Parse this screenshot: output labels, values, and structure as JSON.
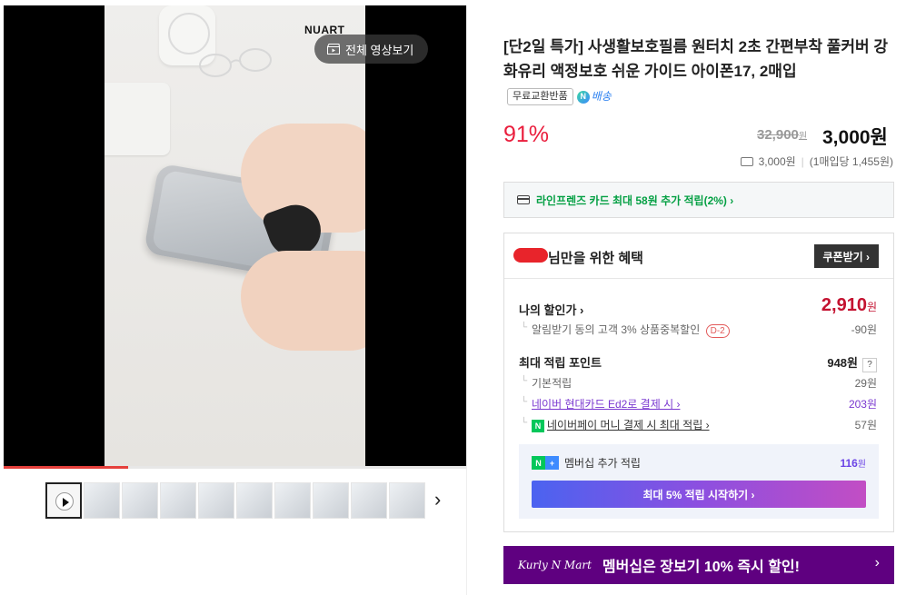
{
  "media": {
    "brand": "NUART",
    "video_button_label": "전체 영상보기",
    "progress_percent": 27
  },
  "thumbnails": {
    "count": 10,
    "next_label": "›"
  },
  "product": {
    "title": "[단2일 특가] 사생활보호필름 원터치 2초 간편부착 풀커버 강화유리 액정보호 쉬운 가이드 아이폰17, 2매입",
    "badge_free_exchange": "무료교환반품",
    "badge_delivery": "배송",
    "discount_rate": "91%",
    "original_price": "32,900",
    "original_currency": "원",
    "sale_price": "3,000원",
    "shipping_price": "3,000원",
    "unit_price": "(1매입당 1,455원)"
  },
  "card_promo": {
    "text": "라인프렌즈 카드 최대 58원 추가 적립(2%) ›"
  },
  "benefit": {
    "title": "님만을 위한 혜택",
    "coupon_button": "쿠폰받기 ›",
    "my_price_label": "나의 할인가 ›",
    "my_price_value": "2,910",
    "my_price_unit": "원",
    "alarm_discount_label": "알림받기 동의 고객 3% 상품중복할인",
    "alarm_discount_badge": "D-2",
    "alarm_discount_value": "-90원",
    "points_label": "최대 적립 포인트",
    "points_value": "948원",
    "points_help": "?",
    "basic_label": "기본적립",
    "basic_value": "29원",
    "card_label": "네이버 현대카드 Ed2로 결제 시 ›",
    "card_value": "203원",
    "npay_label": "네이버페이 머니 결제 시 최대 적립 ›",
    "npay_value": "57원",
    "member_label": "멤버십 추가 적립",
    "member_value": "116",
    "member_unit": "원",
    "member_button": "최대 5% 적립 시작하기 ›"
  },
  "kurly": {
    "logo": "Kurly N Mart",
    "text": "멤버십은 장보기 10% 즉시 할인!",
    "chevron": "›"
  }
}
